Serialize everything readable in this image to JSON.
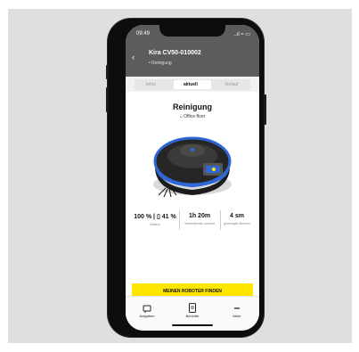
{
  "status_bar": {
    "time": "09:49",
    "icons": "..ıl ≈ ▭"
  },
  "header": {
    "back_icon": "chevron-left",
    "title": "Kira CV50-010002",
    "subtitle": "• Reinigung"
  },
  "tabs": [
    {
      "label": "Infos",
      "active": false
    },
    {
      "label": "aktuell",
      "active": true
    },
    {
      "label": "Verlauf",
      "active": false
    }
  ],
  "main": {
    "heading": "Reinigung",
    "room": "⌂ Office floor",
    "accent_color": "#2f68d6"
  },
  "stats": [
    {
      "value": "100 % | ▯ 41 %",
      "label": "Battery"
    },
    {
      "value": "1h 20m",
      "label": "Verbleibende Laufzeit"
    },
    {
      "value": "4 sm",
      "label": "gereinigter Bereich"
    }
  ],
  "find_button": {
    "label": "MEINEN ROBOTER FINDEN",
    "color": "#ffe600"
  },
  "bottom_nav": [
    {
      "label": "Aufgaben",
      "icon": "task-icon"
    },
    {
      "label": "Berichte",
      "icon": "report-icon"
    },
    {
      "label": "Mehr",
      "icon": "more-icon"
    }
  ]
}
